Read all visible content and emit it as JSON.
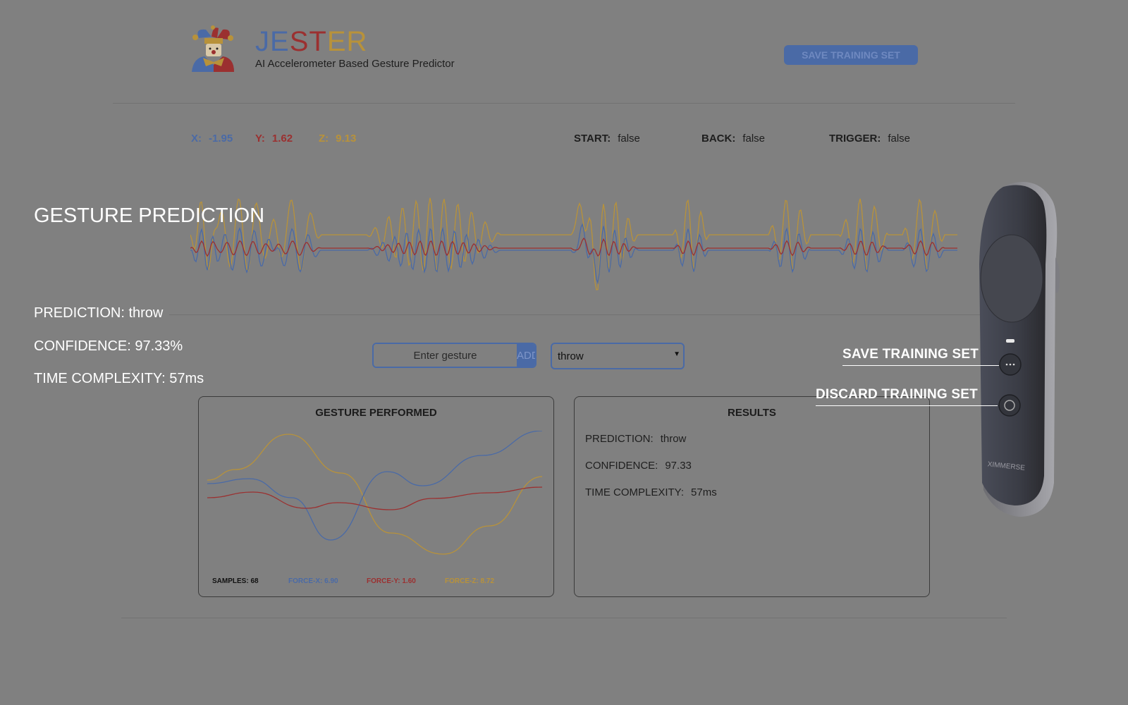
{
  "app": {
    "title_parts": [
      "JE",
      "ST",
      "ER"
    ],
    "subtitle": "AI Accelerometer Based Gesture Predictor",
    "save_button": "SAVE TRAINING SET"
  },
  "accel": {
    "x_label": "X:",
    "x_value": "-1.95",
    "y_label": "Y:",
    "y_value": "1.62",
    "z_label": "Z:",
    "z_value": "9.13"
  },
  "buttons_state": {
    "start_label": "START:",
    "start_value": "false",
    "back_label": "BACK:",
    "back_value": "false",
    "trigger_label": "TRIGGER:",
    "trigger_value": "false"
  },
  "overlay": {
    "heading": "GESTURE PREDICTION",
    "prediction": "PREDICTION: throw",
    "confidence": "CONFIDENCE: 97.33%",
    "time": "TIME COMPLEXITY: 57ms"
  },
  "controls": {
    "gesture_placeholder": "Enter gesture",
    "add_label": "ADD",
    "selected_gesture": "throw"
  },
  "gesture_panel": {
    "title": "GESTURE PERFORMED",
    "samples": "SAMPLES: 68",
    "force_x": "FORCE-X: 6.90",
    "force_y": "FORCE-Y: 1.60",
    "force_z": "FORCE-Z: 8.72"
  },
  "results": {
    "title": "RESULTS",
    "prediction_label": "PREDICTION:",
    "prediction_value": "throw",
    "confidence_label": "CONFIDENCE:",
    "confidence_value": "97.33",
    "time_label": "TIME COMPLEXITY:",
    "time_value": "57ms"
  },
  "controller": {
    "brand": "XIMMERSE",
    "save_callout": "SAVE TRAINING SET",
    "discard_callout": "DISCARD TRAINING SET"
  },
  "colors": {
    "x": "#4a6aa6",
    "y": "#9b3030",
    "z": "#b8923a",
    "accent": "#4a6aa6",
    "background": "#808080"
  }
}
